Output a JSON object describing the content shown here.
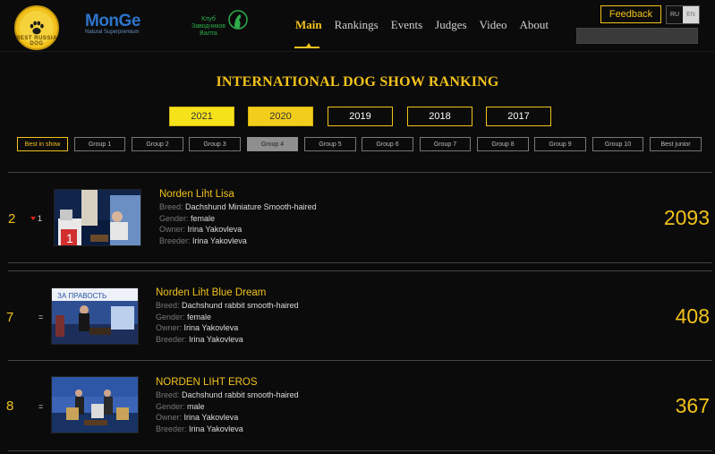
{
  "header": {
    "logo_ring_text": "BEST RUSSIA DOG",
    "sponsor_brand": "MonGe",
    "sponsor_tagline": "Natural Superpremium",
    "club_name": "Клуб Заводчиков Валта",
    "nav": [
      {
        "label": "Main",
        "active": true
      },
      {
        "label": "Rankings",
        "active": false
      },
      {
        "label": "Events",
        "active": false
      },
      {
        "label": "Judges",
        "active": false
      },
      {
        "label": "Video",
        "active": false
      },
      {
        "label": "About",
        "active": false
      }
    ],
    "feedback_label": "Feedback",
    "lang_ru": "RU",
    "lang_en": "EN",
    "search_placeholder": ""
  },
  "title": "INTERNATIONAL DOG SHOW RANKING",
  "years": [
    "2021",
    "2020",
    "2019",
    "2018",
    "2017"
  ],
  "groups": [
    "Best in show",
    "Group 1",
    "Group 2",
    "Group 3",
    "Group 4",
    "Group 5",
    "Group 6",
    "Group 7",
    "Group 8",
    "Group 9",
    "Group 10",
    "Best junior"
  ],
  "labels": {
    "breed": "Breed:",
    "gender": "Gender:",
    "owner": "Owner:",
    "breeder": "Breeder:"
  },
  "rows": [
    {
      "rank": "2",
      "change": "1",
      "change_dir": "down",
      "name": "Norden Liht Lisa",
      "breed": "Dachshund Miniature Smooth-haired",
      "gender": "female",
      "owner": "Irina Yakovleva",
      "breeder": "Irina Yakovleva",
      "points": "2093"
    },
    {
      "rank": "7",
      "change": "=",
      "change_dir": "same",
      "name": "Norden Liht Blue Dream",
      "breed": "Dachshund rabbit smooth-haired",
      "gender": "female",
      "owner": "Irina Yakovleva",
      "breeder": "Irina Yakovleva",
      "points": "408"
    },
    {
      "rank": "8",
      "change": "=",
      "change_dir": "same",
      "name": "NORDEN LIHT EROS",
      "breed": "Dachshund rabbit smooth-haired",
      "gender": "male",
      "owner": "Irina Yakovleva",
      "breeder": "Irina Yakovleva",
      "points": "367"
    }
  ],
  "colors": {
    "accent": "#f2c21b",
    "background": "#0b0b0b",
    "down_arrow": "#e2231a"
  }
}
